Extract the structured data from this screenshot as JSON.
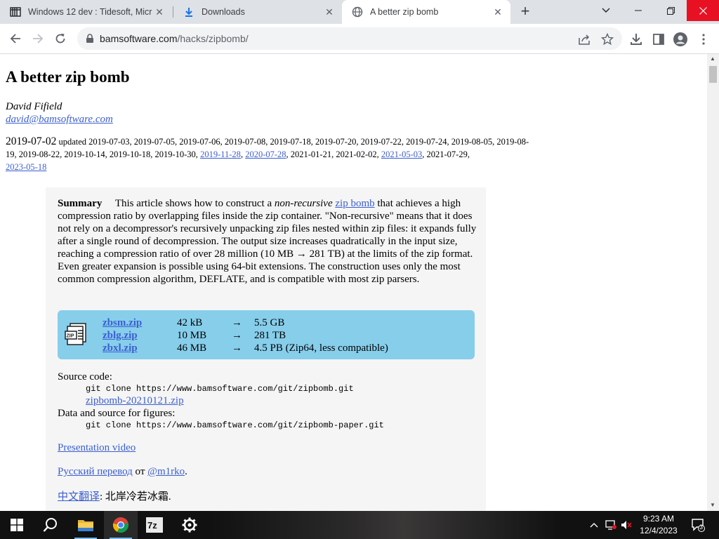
{
  "browser": {
    "tabs": [
      {
        "title": "Windows 12 dev : Tidesoft, Micr",
        "icon": "archive-icon",
        "active": false
      },
      {
        "title": "Downloads",
        "icon": "download-icon",
        "active": false
      },
      {
        "title": "A better zip bomb",
        "icon": "globe-icon",
        "active": true
      }
    ],
    "new_tab_label": "+",
    "address": {
      "domain": "bamsoftware.com",
      "path": "/hacks/zipbomb/"
    }
  },
  "article": {
    "title": "A better zip bomb",
    "author": "David Fifield",
    "email": "david@bamsoftware.com",
    "date": "2019-07-02",
    "updated_label": "updated",
    "updates_line1": "2019-07-03, 2019-07-05, 2019-07-06, 2019-07-08, 2019-07-18, 2019-07-20, 2019-07-22, 2019-07-24, 2019-08-05,",
    "updates_line2_a": "2019-08-19, 2019-08-22, 2019-10-14, 2019-10-18, 2019-10-30,",
    "updates_link1": "2019-11-28",
    "updates_link2": "2020-07-28",
    "updates_line2_b": ", 2021-01-21, 2021-02-02,",
    "updates_link3": "2021-05-03",
    "updates_line2_c": ", 2021-07-29,",
    "updates_link4": "2023-05-18",
    "summary": {
      "heading": "Summary",
      "text_1": "This article shows how to construct a",
      "text_em": "non-recursive",
      "text_link": "zip bomb",
      "text_2": "that achieves a high compression ratio by overlapping files inside the zip container. \"Non-recursive\" means that it does not rely on a decompressor's recursively unpacking zip files nested within zip files: it expands fully after a single round of decompression. The output size increases quadratically in the input size, reaching a compression ratio of over 28 million (10 MB → 281 TB) at the limits of the zip format. Even greater expansion is possible using 64-bit extensions. The construction uses only the most common compression algorithm, DEFLATE, and is compatible with most zip parsers."
    },
    "downloads": [
      {
        "name": "zbsm.zip",
        "size": "42 kB",
        "arrow": "→",
        "output": "5.5 GB"
      },
      {
        "name": "zblg.zip",
        "size": "10 MB",
        "arrow": "→",
        "output": "281 TB"
      },
      {
        "name": "zbxl.zip",
        "size": "46 MB",
        "arrow": "→",
        "output": "4.5 PB (Zip64, less compatible)"
      }
    ],
    "source_label": "Source code:",
    "source_cmd": "git clone https://www.bamsoftware.com/git/zipbomb.git",
    "source_zip": "zipbomb-20210121.zip",
    "data_label": "Data and source for figures:",
    "data_cmd": "git clone https://www.bamsoftware.com/git/zipbomb-paper.git",
    "presentation": "Presentation video",
    "russian_link": "Русский перевод",
    "russian_by": "от",
    "russian_author": "@m1rko",
    "chinese_link": "中文翻译",
    "chinese_rest": ": 北岸冷若冰霜."
  },
  "taskbar": {
    "time": "9:23 AM",
    "date": "12/4/2023",
    "notifications": "3"
  }
}
